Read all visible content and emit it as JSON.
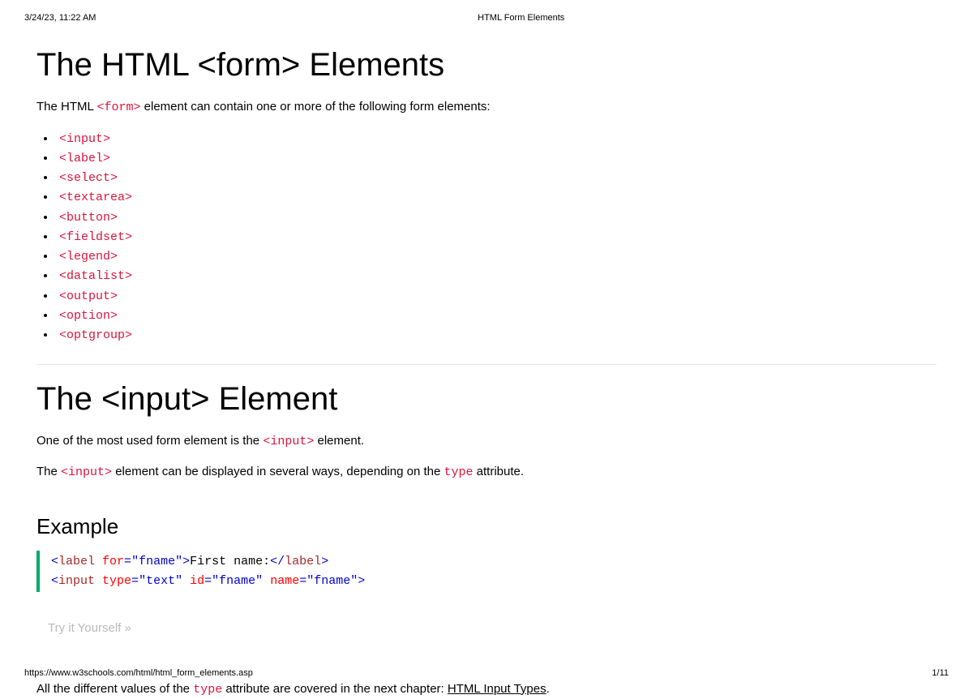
{
  "print": {
    "datetime": "3/24/23, 11:22 AM",
    "title": "HTML Form Elements",
    "url": "https://www.w3schools.com/html/html_form_elements.asp",
    "page": "1/11"
  },
  "section1": {
    "heading": "The HTML <form> Elements",
    "intro_prefix": "The HTML ",
    "intro_code": "<form>",
    "intro_suffix": " element can contain one or more of the following form elements:",
    "elements": [
      "<input>",
      "<label>",
      "<select>",
      "<textarea>",
      "<button>",
      "<fieldset>",
      "<legend>",
      "<datalist>",
      "<output>",
      "<option>",
      "<optgroup>"
    ]
  },
  "section2": {
    "heading": "The <input> Element",
    "p1_prefix": "One of the most used form element is the ",
    "p1_code": "<input>",
    "p1_suffix": " element.",
    "p2_prefix": "The ",
    "p2_code1": "<input>",
    "p2_mid": " element can be displayed in several ways, depending on the ",
    "p2_code2": "type",
    "p2_suffix": " attribute.",
    "example_label": "Example",
    "try_label": "Try it Yourself »",
    "code": {
      "lt": "<",
      "gt": ">",
      "slash": "</",
      "tag_label": "label",
      "tag_input": "input",
      "attr_for": " for",
      "attr_type": " type",
      "attr_id": " id",
      "attr_name": " name",
      "eq": "=",
      "q": "\"",
      "val_fname": "fname",
      "val_text": "text",
      "text_firstname": "First name:"
    },
    "closing_prefix": "All the different values of the ",
    "closing_code": "type",
    "closing_mid": " attribute are covered in the next chapter: ",
    "closing_link": "HTML Input Types",
    "closing_suffix": "."
  }
}
